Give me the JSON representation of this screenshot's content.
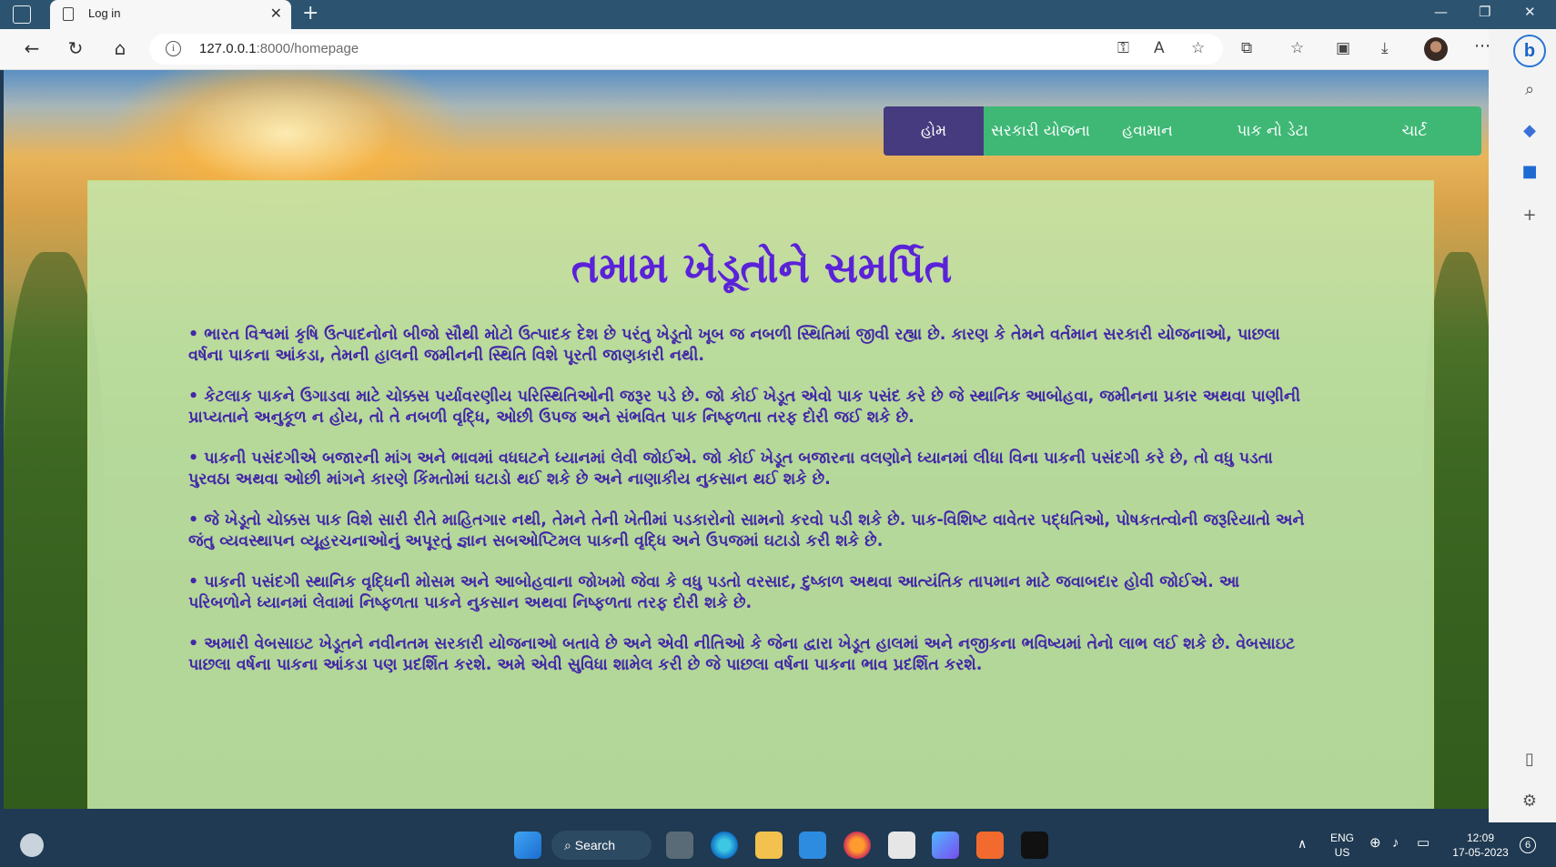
{
  "browser": {
    "tab_title": "Log in",
    "url_host": "127.0.0.1",
    "url_path": ":8000/homepage"
  },
  "nav": {
    "items": [
      {
        "label": "હોમ",
        "active": true
      },
      {
        "label": "સરકારી યોજના",
        "active": false
      },
      {
        "label": "હવામાન",
        "active": false
      },
      {
        "label": "પાક નો ડેટા",
        "active": false
      },
      {
        "label": "ચાર્ટ",
        "active": false
      }
    ]
  },
  "page": {
    "headline": "તમામ ખેડૂતોને સમર્પિત",
    "paragraphs": [
      "ભારત વિશ્વમાં કૃષિ ઉત્પાદનોનો બીજો સૌથી મોટો ઉત્પાદક દેશ છે પરંતુ ખેડૂતો ખૂબ જ નબળી સ્થિતિમાં જીવી રહ્યા છે. કારણ કે તેમને વર્તમાન સરકારી યોજનાઓ, પાછલા વર્ષના પાકના આંકડા, તેમની હાલની જમીનની સ્થિતિ વિશે પૂરતી જાણકારી નથી.",
      "કેટલાક પાકને ઉગાડવા માટે ચોક્કસ પર્યાવરણીય પરિસ્થિતિઓની જરૂર પડે છે. જો કોઈ ખેડૂત એવો પાક પસંદ કરે છે જે સ્થાનિક આબોહવા, જમીનના પ્રકાર અથવા પાણીની પ્રાપ્યતાને અનુકૂળ ન હોય, તો તે નબળી વૃદ્ધિ, ઓછી ઉપજ અને સંભવિત પાક નિષ્ફળતા તરફ દોરી જઈ શકે છે.",
      "પાકની પસંદગીએ બજારની માંગ અને ભાવમાં વધઘટને ધ્યાનમાં લેવી જોઈએ. જો કોઈ ખેડૂત બજારના વલણોને ધ્યાનમાં લીધા વિના પાકની પસંદગી કરે છે, તો વધુ પડતા પુરવઠા અથવા ઓછી માંગને કારણે કિંમતોમાં ઘટાડો થઈ શકે છે અને નાણાકીય નુકસાન થઈ શકે છે.",
      "જે ખેડૂતો ચોક્કસ પાક વિશે સારી રીતે માહિતગાર નથી, તેમને તેની ખેતીમાં પડકારોનો સામનો કરવો પડી શકે છે. પાક-વિશિષ્ટ વાવેતર પદ્ધતિઓ, પોષકતત્વોની જરૂરિયાતો અને જંતુ વ્યવસ્થાપન વ્યૂહરચનાઓનું અપૂરતું જ્ઞાન સબઓપ્ટિમલ પાકની વૃદ્ધિ અને ઉપજમાં ઘટાડો કરી શકે છે.",
      "પાકની પસંદગી સ્થાનિક વૃદ્ધિની મોસમ અને આબોહવાના જોખમો જેવા કે વધુ પડતો વરસાદ, દુષ્કાળ અથવા આત્યંતિક તાપમાન માટે જવાબદાર હોવી જોઈએ. આ પરિબળોને ધ્યાનમાં લેવામાં નિષ્ફળતા પાકને નુકસાન અથવા નિષ્ફળતા તરફ દોરી શકે છે.",
      "અમારી વેબસાઇટ ખેડૂતને નવીનતમ સરકારી યોજનાઓ બતાવે છે અને એવી નીતિઓ કે જેના દ્વારા ખેડૂત હાલમાં અને નજીકના ભવિષ્યમાં તેનો લાભ લઈ શકે છે. વેબસાઇટ પાછલા વર્ષના પાકના આંકડા પણ પ્રદર્શિત કરશે. અમે એવી સુવિધા શામેલ કરી છે જે પાછલા વર્ષના પાકના ભાવ પ્રદર્શિત કરશે."
    ]
  },
  "taskbar": {
    "search_label": "Search",
    "lang_line1": "ENG",
    "lang_line2": "US",
    "time": "12:09",
    "date": "17-05-2023",
    "notification_count": "6"
  },
  "colors": {
    "nav_bg": "#3fb876",
    "nav_active": "#453b7e",
    "headline": "#5a22d8",
    "body_text": "#4327a8",
    "card_bg": "#c4e6aa"
  },
  "icons": [
    "tab-actions-icon",
    "page-icon",
    "close-icon",
    "plus-icon",
    "minimize-icon",
    "restore-icon",
    "back-icon",
    "refresh-icon",
    "home-icon",
    "info-icon",
    "key-icon",
    "read-aloud-icon",
    "favorite-add-icon",
    "extensions-icon",
    "favorites-icon",
    "collections-icon",
    "download-icon",
    "more-icon",
    "bing-icon",
    "search-icon",
    "copilot-icon",
    "outlook-icon",
    "windows-icon",
    "edge-icon",
    "folder-icon",
    "mail-icon",
    "firefox-icon",
    "store-icon",
    "settings-icon"
  ]
}
